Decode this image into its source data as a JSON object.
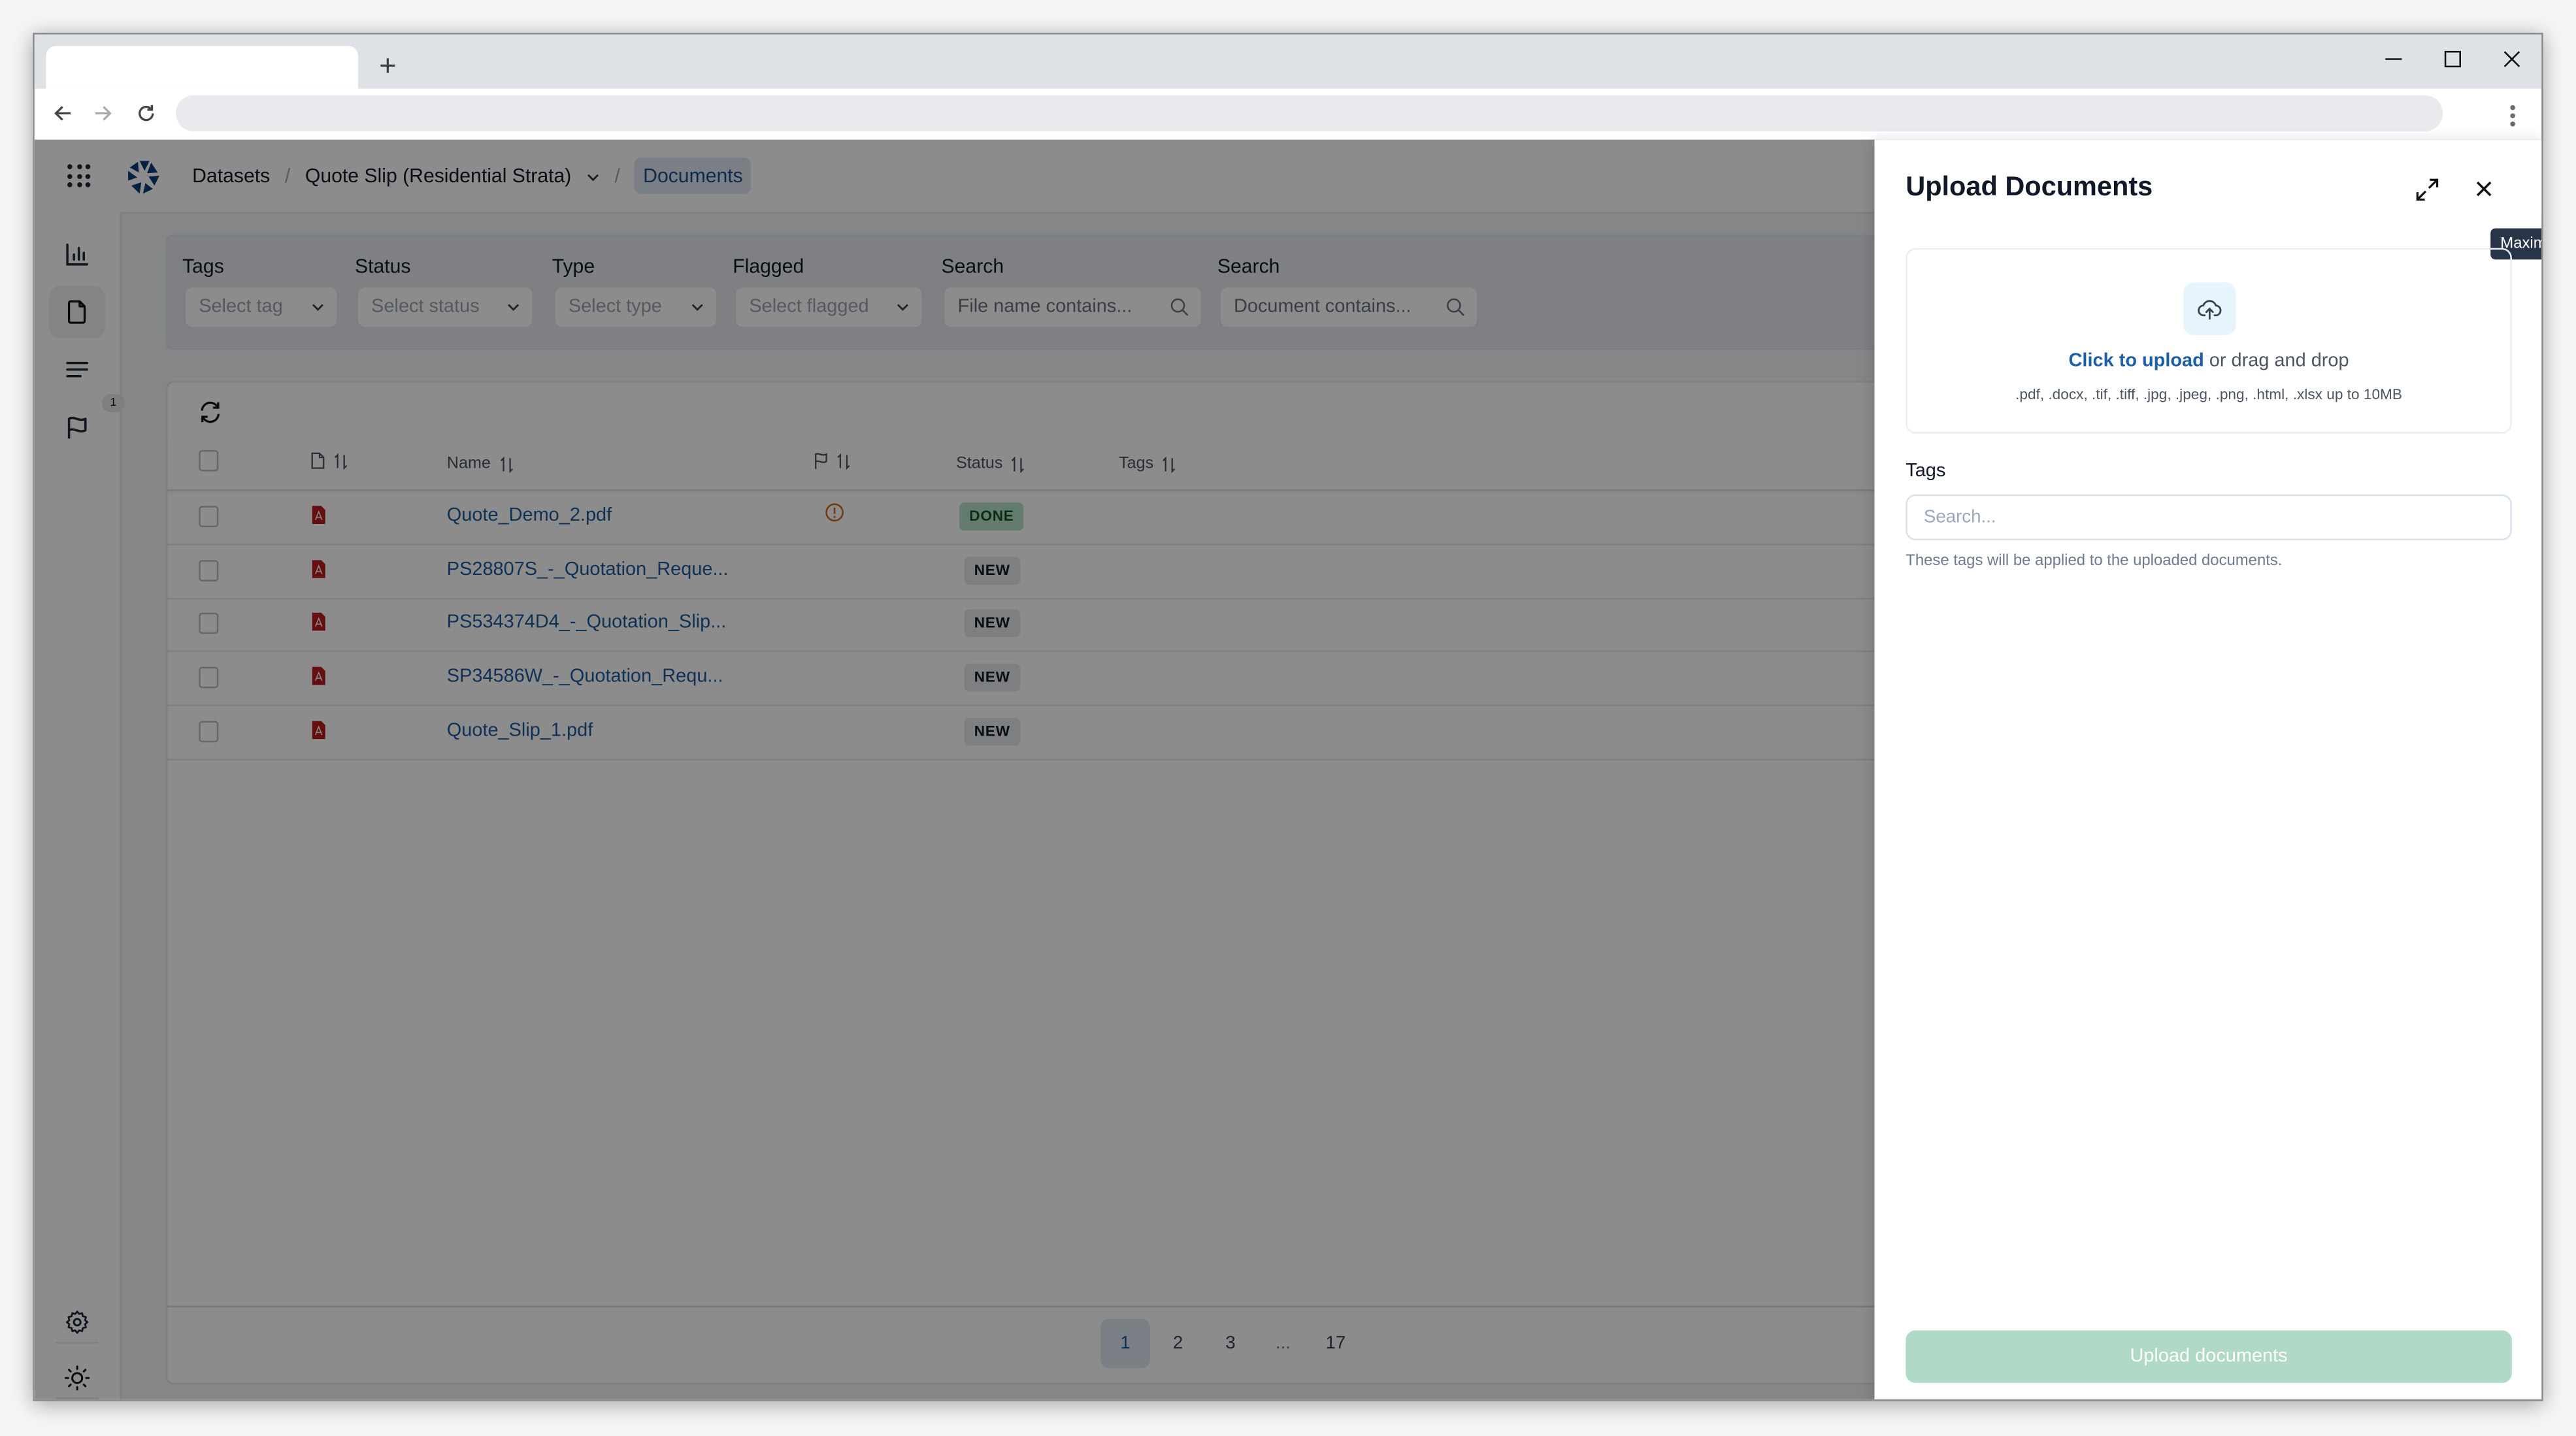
{
  "browser": {
    "new_tab_label": "+",
    "address": ""
  },
  "header": {
    "breadcrumbs": [
      {
        "label": "Datasets"
      },
      {
        "label": "Quote Slip (Residential Strata)"
      },
      {
        "label": "Documents"
      }
    ],
    "separator": "/"
  },
  "sidebar": {
    "items": [
      {
        "icon": "bar-chart-icon",
        "label": "Analytics"
      },
      {
        "icon": "document-icon",
        "label": "Documents",
        "active": true
      },
      {
        "icon": "lines-icon",
        "label": "Fields"
      },
      {
        "icon": "flag-icon",
        "label": "Flags",
        "badge": "1"
      }
    ],
    "bottom": [
      {
        "icon": "gear-icon"
      },
      {
        "icon": "sun-icon"
      },
      {
        "icon": "chevrons-right-icon"
      }
    ]
  },
  "filters": {
    "tags": {
      "label": "Tags",
      "placeholder": "Select tag"
    },
    "status": {
      "label": "Status",
      "placeholder": "Select status"
    },
    "type": {
      "label": "Type",
      "placeholder": "Select type"
    },
    "flagged": {
      "label": "Flagged",
      "placeholder": "Select flagged"
    },
    "search_name": {
      "label": "Search",
      "placeholder": "File name contains..."
    },
    "search_doc": {
      "label": "Search",
      "placeholder": "Document contains..."
    }
  },
  "table": {
    "columns": {
      "name": "Name",
      "status": "Status",
      "tags": "Tags"
    },
    "rows": [
      {
        "name": "Quote_Demo_2.pdf",
        "flagged": true,
        "status": "DONE"
      },
      {
        "name": "PS28807S_-_Quotation_Reque...",
        "flagged": false,
        "status": "NEW"
      },
      {
        "name": "PS534374D4_-_Quotation_Slip...",
        "flagged": false,
        "status": "NEW"
      },
      {
        "name": "SP34586W_-_Quotation_Requ...",
        "flagged": false,
        "status": "NEW"
      },
      {
        "name": "Quote_Slip_1.pdf",
        "flagged": false,
        "status": "NEW"
      }
    ]
  },
  "pagination": {
    "pages": [
      "1",
      "2",
      "3",
      "...",
      "17"
    ],
    "current": "1"
  },
  "upload_panel": {
    "title": "Upload Documents",
    "tooltip": "Maximize",
    "click_to_upload": "Click to upload",
    "drag_text": " or drag and drop",
    "formats": ".pdf, .docx, .tif, .tiff, .jpg, .jpeg, .png, .html, .xlsx up to 10MB",
    "tags_label": "Tags",
    "tags_placeholder": "Search...",
    "tags_help": "These tags will be applied to the uploaded documents.",
    "submit_label": "Upload documents"
  },
  "colors": {
    "brand": "#0b3a78",
    "link": "#1d5fa6",
    "done_badge": "#b7e2c6",
    "new_badge": "#e5e8ec",
    "upload_button_disabled": "#b0dac5",
    "pdf_red": "#b91c1c",
    "warning_orange": "#d9660f"
  }
}
